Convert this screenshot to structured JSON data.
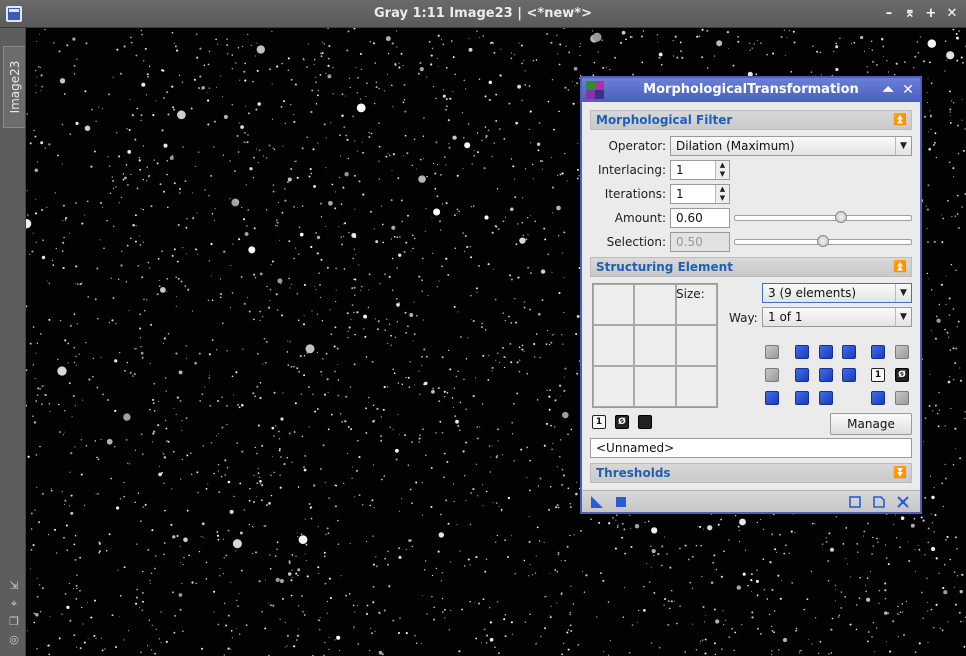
{
  "window": {
    "title": "Gray 1:11 Image23 | <*new*>",
    "buttons": [
      "minimize-icon",
      "shade-icon",
      "maximize-icon",
      "close-icon"
    ],
    "side_tab": "Image23"
  },
  "dialog": {
    "title": "MorphologicalTransformation",
    "sections": {
      "filter": "Morphological Filter",
      "structuring": "Structuring Element",
      "thresholds": "Thresholds"
    },
    "operator": {
      "label": "Operator:",
      "value": "Dilation (Maximum)"
    },
    "interlacing": {
      "label": "Interlacing:",
      "value": "1"
    },
    "iterations": {
      "label": "Iterations:",
      "value": "1"
    },
    "amount": {
      "label": "Amount:",
      "value": "0.60",
      "level": 0.6
    },
    "selection": {
      "label": "Selection:",
      "value": "0.50",
      "level": 0.5,
      "enabled": false
    },
    "size": {
      "label": "Size:",
      "value": "3  (9 elements)"
    },
    "way": {
      "label": "Way:",
      "value": "1 of 1"
    },
    "grid_cells": 9,
    "manage_label": "Manage",
    "element_name": "<Unnamed>",
    "grid_tool_labels": [
      "1",
      "Ø"
    ],
    "accent": "#4e5fb5",
    "section_color": "#1f5fb4"
  }
}
